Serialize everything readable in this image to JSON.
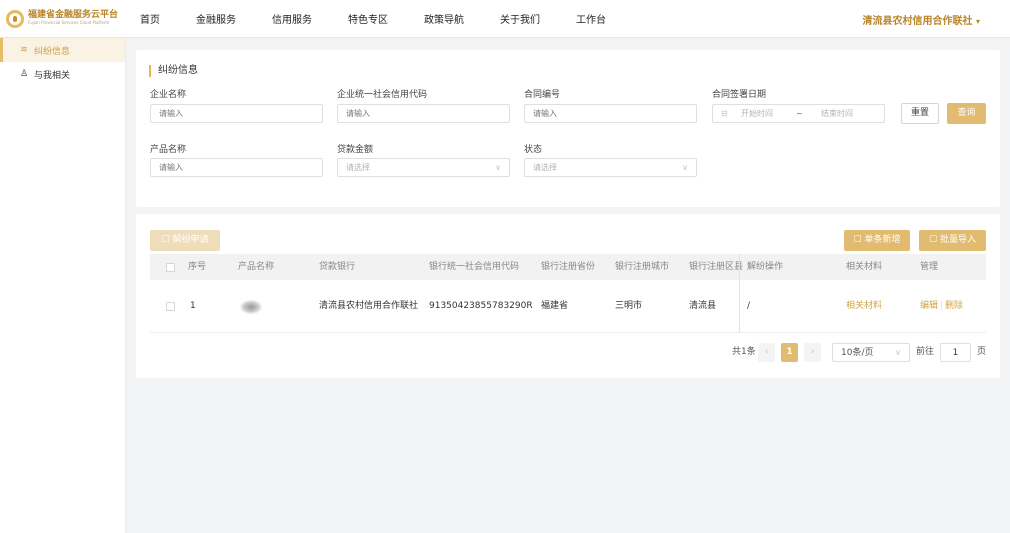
{
  "brand": {
    "title": "福建省金融服务云平台",
    "subtitle": "Fujian Provincial Services Cloud Platform"
  },
  "nav": {
    "items": [
      "首页",
      "金融服务",
      "信用服务",
      "特色专区",
      "政策导航",
      "关于我们",
      "工作台"
    ],
    "org": "清流县农村信用合作联社",
    "org_caret": "▾"
  },
  "sidebar": {
    "items": [
      {
        "label": "纠纷信息",
        "icon": "≋",
        "active": true
      },
      {
        "label": "与我相关",
        "icon": "♙",
        "active": false
      }
    ]
  },
  "search": {
    "title": "纠纷信息",
    "fields": {
      "company_name": {
        "label": "企业名称",
        "placeholder": "请输入"
      },
      "credit_code": {
        "label": "企业统一社会信用代码",
        "placeholder": "请输入"
      },
      "contract_no": {
        "label": "合同编号",
        "placeholder": "请输入"
      },
      "sign_date": {
        "label": "合同签署日期",
        "start": "开始时间",
        "sep": "~",
        "end": "结束时间",
        "icon": "⊟"
      },
      "product_name": {
        "label": "产品名称",
        "placeholder": "请输入"
      },
      "loan_amount": {
        "label": "贷款金额",
        "placeholder": "请选择"
      },
      "status": {
        "label": "状态",
        "placeholder": "请选择"
      }
    },
    "caret": "∨",
    "reset_label": "重置",
    "query_label": "查询"
  },
  "toolbar": {
    "dispute_apply": "解纷申请",
    "single_add": "单条新增",
    "batch_import": "批量导入",
    "icon_apply": "☐",
    "icon_add": "☐",
    "icon_import": "☐"
  },
  "table": {
    "headers": [
      "序号",
      "产品名称",
      "贷款银行",
      "银行统一社会信用代码",
      "银行注册省份",
      "银行注册城市",
      "银行注册区县",
      "解纷操作",
      "相关材料",
      "管理"
    ],
    "rows": [
      {
        "index": "1",
        "product": "",
        "bank": "清流县农村信用合作联社",
        "bank_code": "91350423855783290R",
        "province": "福建省",
        "city": "三明市",
        "district": "清流县",
        "action": "/",
        "materials": "相关材料",
        "edit": "编辑",
        "sep": "|",
        "delete": "删除"
      }
    ]
  },
  "pagination": {
    "total": "共1条",
    "prev": "‹",
    "current": "1",
    "next": "›",
    "page_size": "10条/页",
    "goto_label": "前往",
    "goto_value": "1",
    "page_suffix": "页"
  }
}
